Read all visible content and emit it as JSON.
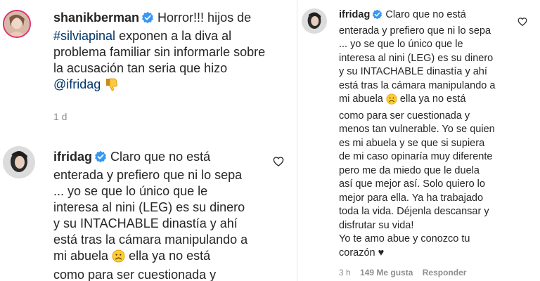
{
  "left": {
    "post": {
      "username": "shanikberman",
      "text_line1": " Horror!!! hijos de",
      "hashtag": "#silviapinal",
      "text_line2_rest": " exponen a la diva al",
      "text_line3": "problema familiar sin informarle sobre",
      "text_line4": "la acusación tan seria que hizo",
      "mention": "@ifridag",
      "time": "1 d"
    },
    "reply": {
      "username": "ifridag",
      "lines": [
        " Claro que no está",
        "enterada y prefiero que ni lo sepa",
        "... yo se que lo único que le",
        "interesa al nini (LEG) es su dinero",
        "y su INTACHABLE dinastía y ahí",
        "está tras la cámara manipulando a",
        "mi abuela",
        " ella ya no está",
        "como para ser cuestionada y"
      ]
    }
  },
  "right": {
    "username": "ifridag",
    "lines": [
      " Claro que no está",
      "enterada y prefiero que ni lo sepa",
      "... yo se que lo único que le",
      "interesa al nini (LEG) es su dinero",
      "y su INTACHABLE dinastía y ahí",
      "está tras la cámara manipulando a",
      "mi abuela",
      " ella ya no está",
      "como para ser cuestionada y",
      "menos tan vulnerable. Yo se quien",
      "es mi abuela y se que si supiera",
      "de mi caso opinaría muy diferente",
      "pero me da miedo que le duela",
      "así que mejor así. Solo quiero lo",
      "mejor para ella. Ya ha trabajado",
      "toda la vida. Déjenla descansar y",
      "disfrutar su vida!",
      "Yo te amo abue y conozco tu",
      "corazón",
      " ♥"
    ],
    "time": "3 h",
    "likes": "149 Me gusta",
    "reply_label": "Responder"
  },
  "icons": {
    "verified": "verified-badge-icon",
    "heart": "heart-outline-icon",
    "thumbs_down": "thumbs-down-emoji",
    "sad_face": "sad-face-emoji"
  },
  "colors": {
    "verified_blue": "#3897f0",
    "mention_blue": "#00376b",
    "secondary_gray": "#8e8e8e"
  }
}
